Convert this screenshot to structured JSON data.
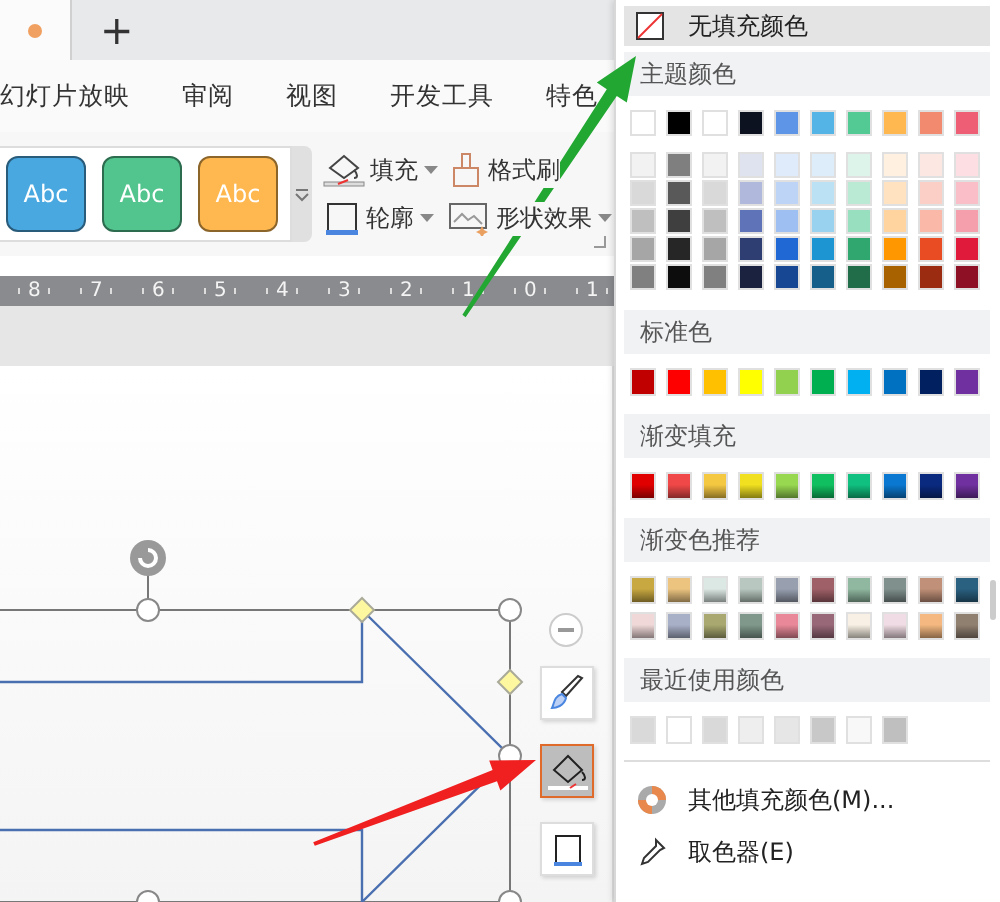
{
  "document_tab": {
    "modified": true
  },
  "new_tab_button": "+",
  "menu": [
    "幻灯片放映",
    "审阅",
    "视图",
    "开发工具",
    "特色"
  ],
  "gallery": [
    {
      "label": "Abc",
      "color": "#4aa8e0"
    },
    {
      "label": "Abc",
      "color": "#52c48e"
    },
    {
      "label": "Abc",
      "color": "#ffb84f"
    }
  ],
  "ribbon_buttons": [
    {
      "kind": "fill",
      "label": "填充",
      "dropdown": true
    },
    {
      "kind": "brush",
      "label": "格式刷",
      "dropdown": false
    },
    {
      "kind": "outline",
      "label": "轮廓",
      "dropdown": true
    },
    {
      "kind": "effects",
      "label": "形状效果",
      "dropdown": true
    }
  ],
  "ruler": [
    "8",
    "7",
    "6",
    "5",
    "4",
    "3",
    "2",
    "1",
    "0",
    "1"
  ],
  "float_tools": [
    {
      "kind": "brush",
      "selected": false
    },
    {
      "kind": "fill",
      "selected": true
    },
    {
      "kind": "outline",
      "selected": false
    }
  ],
  "color_menu": {
    "no_fill": "无填充颜色",
    "sections": [
      {
        "title": "主题颜色",
        "kind": "theme",
        "rows": [
          [
            {
              "color": "#ffffff"
            },
            {
              "color": "#000000"
            },
            {
              "color": "#ffffff"
            },
            {
              "color": "#0c1220"
            },
            {
              "color": "#5e95e6"
            },
            {
              "color": "#55b4e6"
            },
            {
              "color": "#53c994"
            },
            {
              "color": "#ffb74f"
            },
            {
              "color": "#f28a6f"
            },
            {
              "color": "#ee5e75"
            }
          ],
          [
            {
              "color": "#f2f2f2"
            },
            {
              "color": "#7f7f7f"
            },
            {
              "color": "#f2f2f2"
            },
            {
              "color": "#dfe2ef"
            },
            {
              "color": "#dfeafb"
            },
            {
              "color": "#ddeefa"
            },
            {
              "color": "#ddf4ea"
            },
            {
              "color": "#fff0df"
            },
            {
              "color": "#fde7e2"
            },
            {
              "color": "#fcdee3"
            }
          ],
          [
            {
              "color": "#d9d9d9"
            },
            {
              "color": "#595959"
            },
            {
              "color": "#d9d9d9"
            },
            {
              "color": "#b0b9dc"
            },
            {
              "color": "#bed4f6"
            },
            {
              "color": "#bbe1f5"
            },
            {
              "color": "#bae9d4"
            },
            {
              "color": "#ffe2bf"
            },
            {
              "color": "#fbcfc5"
            },
            {
              "color": "#f9bec8"
            }
          ],
          [
            {
              "color": "#bfbfbf"
            },
            {
              "color": "#3f3f3f"
            },
            {
              "color": "#bfbfbf"
            },
            {
              "color": "#5f74b8"
            },
            {
              "color": "#9ebff1"
            },
            {
              "color": "#99d2ef"
            },
            {
              "color": "#98dfbf"
            },
            {
              "color": "#ffd49f"
            },
            {
              "color": "#f9b8a8"
            },
            {
              "color": "#f59eac"
            }
          ],
          [
            {
              "color": "#a6a6a6"
            },
            {
              "color": "#262626"
            },
            {
              "color": "#a6a6a6"
            },
            {
              "color": "#2e3e72"
            },
            {
              "color": "#2068d4"
            },
            {
              "color": "#1e95d3"
            },
            {
              "color": "#31a770"
            },
            {
              "color": "#ff9800"
            },
            {
              "color": "#e94c22"
            },
            {
              "color": "#df1a3a"
            }
          ],
          [
            {
              "color": "#808080"
            },
            {
              "color": "#0d0d0d"
            },
            {
              "color": "#808080"
            },
            {
              "color": "#1b2240"
            },
            {
              "color": "#174793"
            },
            {
              "color": "#165f8a"
            },
            {
              "color": "#216d4a"
            },
            {
              "color": "#a86300"
            },
            {
              "color": "#9b2c12"
            },
            {
              "color": "#8e1024"
            }
          ]
        ]
      },
      {
        "title": "标准色",
        "kind": "solid",
        "rows": [
          [
            {
              "color": "#c00000"
            },
            {
              "color": "#ff0000"
            },
            {
              "color": "#ffc000"
            },
            {
              "color": "#ffff00"
            },
            {
              "color": "#92d050"
            },
            {
              "color": "#00b050"
            },
            {
              "color": "#00b0f0"
            },
            {
              "color": "#0070c0"
            },
            {
              "color": "#002060"
            },
            {
              "color": "#7030a0"
            }
          ]
        ]
      },
      {
        "title": "渐变填充",
        "kind": "gradient",
        "rows": [
          [
            {
              "color": "#e00000"
            },
            {
              "color": "#f04848"
            },
            {
              "color": "#f5c842"
            },
            {
              "color": "#f0e020"
            },
            {
              "color": "#98d850"
            },
            {
              "color": "#10c060"
            },
            {
              "color": "#10c080"
            },
            {
              "color": "#0a78d0"
            },
            {
              "color": "#0a2a80"
            },
            {
              "color": "#7030a0"
            }
          ]
        ]
      },
      {
        "title": "渐变色推荐",
        "kind": "gradient",
        "rows": [
          [
            {
              "color": "#c8a840"
            },
            {
              "color": "#ecc480"
            },
            {
              "color": "#dce8e4"
            },
            {
              "color": "#b8c8c0"
            },
            {
              "color": "#98a0b0"
            },
            {
              "color": "#a06068"
            },
            {
              "color": "#90b8a0"
            },
            {
              "color": "#80908c"
            },
            {
              "color": "#c09078"
            },
            {
              "color": "#2a6080"
            }
          ],
          [
            {
              "color": "#f0d8d8"
            },
            {
              "color": "#a8b0c8"
            },
            {
              "color": "#a8a870"
            },
            {
              "color": "#80988c"
            },
            {
              "color": "#e88898"
            },
            {
              "color": "#986878"
            },
            {
              "color": "#f8f0e4"
            },
            {
              "color": "#f0dce4"
            },
            {
              "color": "#f4b880"
            },
            {
              "color": "#908070"
            }
          ]
        ]
      },
      {
        "title": "最近使用颜色",
        "kind": "solid",
        "rows": [
          [
            {
              "color": "#d9d9d9"
            },
            {
              "color": "#ffffff"
            },
            {
              "color": "#d9d9d9"
            },
            {
              "color": "#eeeeee"
            },
            {
              "color": "#e6e6e6"
            },
            {
              "color": "#c8c8c8"
            },
            {
              "color": "#f8f8f8"
            },
            {
              "color": "#bfbfbf"
            }
          ]
        ]
      }
    ],
    "footer": [
      {
        "kind": "palette",
        "label": "其他填充颜色(M)..."
      },
      {
        "kind": "picker",
        "label": "取色器(E)"
      }
    ]
  }
}
